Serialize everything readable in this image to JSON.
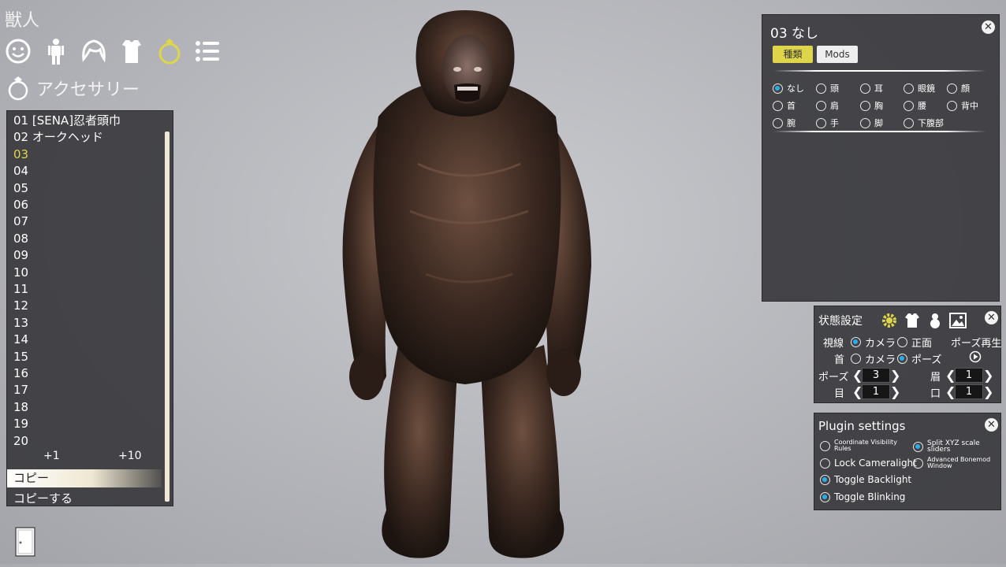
{
  "character_name": "獣人",
  "category_icons": [
    "face-icon",
    "body-icon",
    "hair-icon",
    "clothing-icon",
    "accessory-ring-icon",
    "list-icon"
  ],
  "section_title": "アクセサリー",
  "slots": [
    "01 [SENA]忍者頭巾",
    "02 オークヘッド",
    "03",
    "04",
    "05",
    "06",
    "07",
    "08",
    "09",
    "10",
    "11",
    "12",
    "13",
    "14",
    "15",
    "16",
    "17",
    "18",
    "19",
    "20"
  ],
  "active_slot": "03",
  "plus_one": "+1",
  "plus_ten": "+10",
  "copy_header": "コピー",
  "copy_action": "コピーする",
  "accessory_panel": {
    "title": "03 なし",
    "tab_kind": "種類",
    "tab_mods": "Mods",
    "types": [
      {
        "label": "なし",
        "on": true
      },
      {
        "label": "頭",
        "on": false
      },
      {
        "label": "耳",
        "on": false
      },
      {
        "label": "眼鏡",
        "on": false
      },
      {
        "label": "顔",
        "on": false
      },
      {
        "label": "首",
        "on": false
      },
      {
        "label": "肩",
        "on": false
      },
      {
        "label": "胸",
        "on": false
      },
      {
        "label": "腰",
        "on": false
      },
      {
        "label": "背中",
        "on": false
      },
      {
        "label": "腕",
        "on": false
      },
      {
        "label": "手",
        "on": false
      },
      {
        "label": "脚",
        "on": false
      },
      {
        "label": "下腹部",
        "on": false
      }
    ]
  },
  "state_panel": {
    "title": "状態設定",
    "gaze_label": "視線",
    "gaze_camera": "カメラ",
    "gaze_front": "正面",
    "neck_label": "首",
    "neck_camera": "カメラ",
    "neck_pose": "ポーズ",
    "pose_play": "ポーズ再生",
    "pose_label": "ポーズ",
    "pose_value": "3",
    "brow_label": "眉",
    "brow_value": "1",
    "eye_label": "目",
    "eye_value": "1",
    "mouth_label": "口",
    "mouth_value": "1"
  },
  "plugin_panel": {
    "title": "Plugin settings",
    "coord_vis": "Coordinate Visibility Rules",
    "split_xyz": "Split XYZ scale sliders",
    "lock_cam": "Lock Cameralight",
    "adv_bonemod": "Advanced Bonemod Window",
    "toggle_backlight": "Toggle Backlight",
    "toggle_blinking": "Toggle Blinking"
  },
  "colors": {
    "accent_yellow": "#ded54a",
    "radio_blue": "#28aee8",
    "panel_bg": "#3a3a3e"
  }
}
